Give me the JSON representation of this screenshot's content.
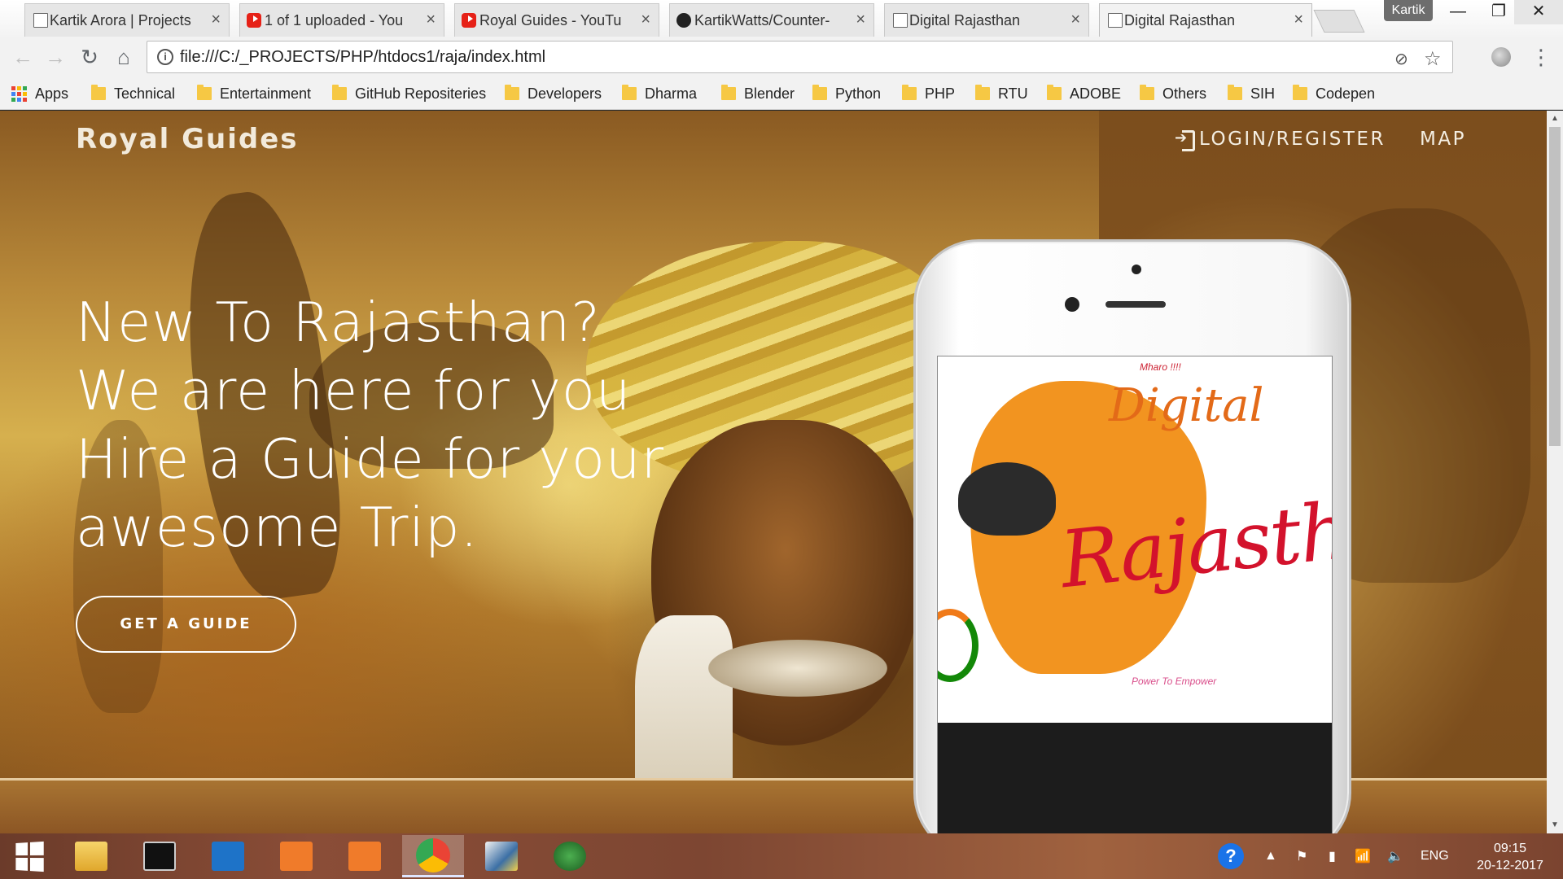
{
  "browser": {
    "tabs": [
      {
        "title": "Kartik Arora | Projects",
        "icon": "page-icon"
      },
      {
        "title": "1 of 1 uploaded - You",
        "icon": "youtube-icon"
      },
      {
        "title": "Royal Guides - YouTu",
        "icon": "youtube-icon"
      },
      {
        "title": "KartikWatts/Counter-",
        "icon": "github-icon"
      },
      {
        "title": "Digital Rajasthan",
        "icon": "page-icon"
      },
      {
        "title": "Digital Rajasthan",
        "icon": "page-icon",
        "active": true
      }
    ],
    "profile_name": "Kartik",
    "url": "file:///C:/_PROJECTS/PHP/htdocs1/raja/index.html",
    "bookmarks": {
      "apps_label": "Apps",
      "folders": [
        "Technical",
        "Entertainment",
        "GitHub Repositeries",
        "Developers",
        "Dharma",
        "Blender",
        "Python",
        "PHP",
        "RTU",
        "ADOBE",
        "Others",
        "SIH",
        "Codepen"
      ]
    }
  },
  "page": {
    "brand": "Royal Guides",
    "nav": {
      "login": "LOGIN/REGISTER",
      "map": "MAP"
    },
    "hero_lines": [
      "New To Rajasthan?",
      "We are here for you",
      "Hire a Guide for your",
      "awesome Trip."
    ],
    "cta": "GET A GUIDE",
    "phone_app": {
      "greeting": "Mharo !!!!",
      "title_top": "Digital",
      "title_main": "Rajasthan",
      "tagline": "Power To Empower"
    }
  },
  "taskbar": {
    "language": "ENG",
    "time": "09:15",
    "date": "20-12-2017"
  },
  "colors": {
    "accent_white": "#ffffff",
    "orange_map": "#f29420",
    "red_script": "#d3122c"
  }
}
